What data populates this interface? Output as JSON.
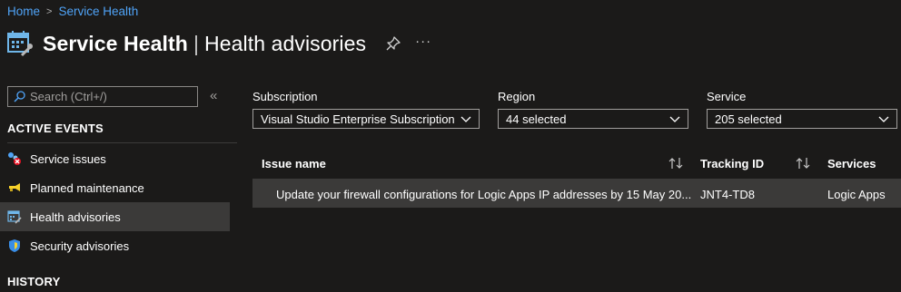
{
  "breadcrumb": {
    "home": "Home",
    "current": "Service Health"
  },
  "header": {
    "title_bold": "Service Health",
    "separator": "|",
    "title_light": "Health advisories",
    "more": "···"
  },
  "sidebar": {
    "search_placeholder": "Search (Ctrl+/)",
    "collapse": "«",
    "active_events_title": "ACTIVE EVENTS",
    "items": [
      {
        "label": "Service issues",
        "icon": "service-issues-icon"
      },
      {
        "label": "Planned maintenance",
        "icon": "megaphone-icon"
      },
      {
        "label": "Health advisories",
        "icon": "calendar-tools-icon",
        "selected": true
      },
      {
        "label": "Security advisories",
        "icon": "shield-icon"
      }
    ],
    "history_title": "HISTORY"
  },
  "filters": {
    "subscription": {
      "label": "Subscription",
      "value": "Visual Studio Enterprise Subscription"
    },
    "region": {
      "label": "Region",
      "value": "44 selected"
    },
    "service": {
      "label": "Service",
      "value": "205 selected"
    }
  },
  "table": {
    "columns": [
      "Issue name",
      "Tracking ID",
      "Services"
    ],
    "rows": [
      {
        "issue_name": "Update your firewall configurations for Logic Apps IP addresses by 15 May 20...",
        "tracking_id": "JNT4-TD8",
        "services": "Logic Apps"
      }
    ]
  },
  "colors": {
    "background": "#1b1a19",
    "link": "#4fa3f7",
    "selected": "#3b3a39",
    "border": "#a19f9d"
  }
}
